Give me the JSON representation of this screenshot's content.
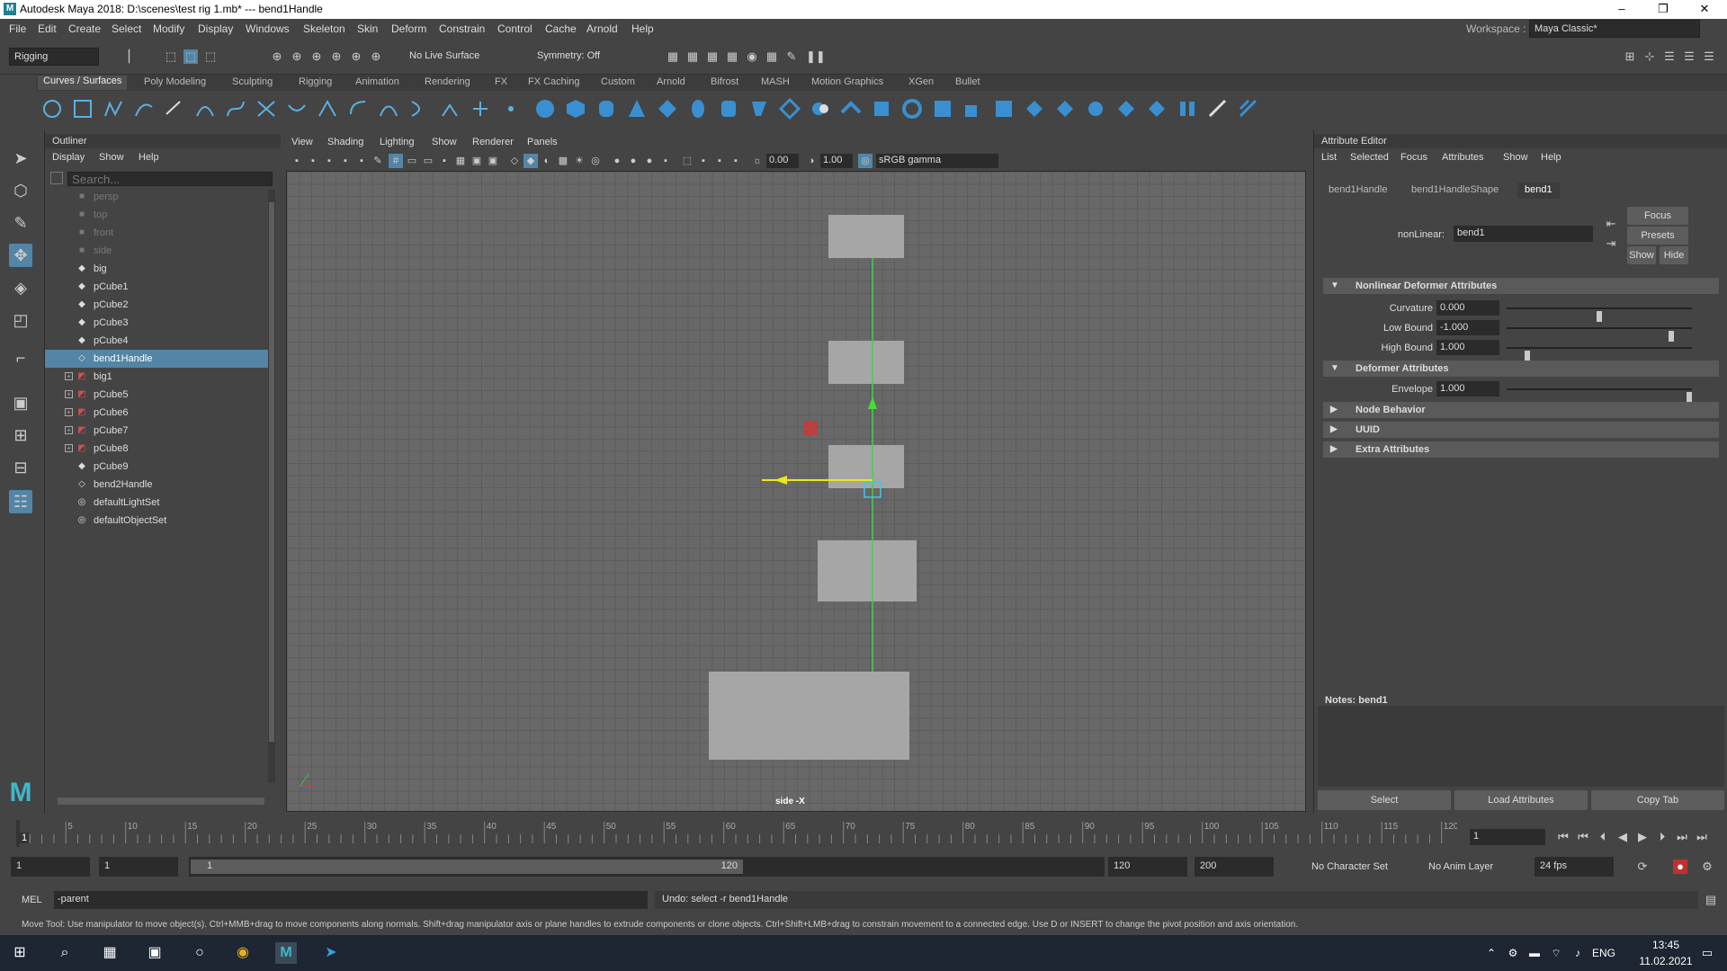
{
  "window": {
    "title": "Autodesk Maya 2018: D:\\scenes\\test rig 1.mb*  ---  bend1Handle",
    "logo": "M"
  },
  "menubar": {
    "items": [
      "File",
      "Edit",
      "Create",
      "Select",
      "Modify",
      "Display",
      "Windows",
      "Skeleton",
      "Skin",
      "Deform",
      "Constrain",
      "Control",
      "Cache",
      "Arnold",
      "Help"
    ],
    "workspace_label": "Workspace :",
    "workspace_value": "Maya Classic*"
  },
  "statusline": {
    "mode": "Rigging",
    "live_surface": "No Live Surface",
    "symmetry": "Symmetry: Off"
  },
  "shelf": {
    "tabs": [
      "Curves / Surfaces",
      "Poly Modeling",
      "Sculpting",
      "Rigging",
      "Animation",
      "Rendering",
      "FX",
      "FX Caching",
      "Custom",
      "Arnold",
      "Bifrost",
      "MASH",
      "Motion Graphics",
      "XGen",
      "Bullet"
    ],
    "active": "Curves / Surfaces"
  },
  "outliner": {
    "title": "Outliner",
    "menu": [
      "Display",
      "Show",
      "Help"
    ],
    "search_placeholder": "Search...",
    "items": [
      {
        "label": "persp",
        "icon": "camera-icon",
        "dim": true,
        "expand": false
      },
      {
        "label": "top",
        "icon": "camera-icon",
        "dim": true,
        "expand": false
      },
      {
        "label": "front",
        "icon": "camera-icon",
        "dim": true,
        "expand": false
      },
      {
        "label": "side",
        "icon": "camera-icon",
        "dim": true,
        "expand": false
      },
      {
        "label": "big",
        "icon": "mesh-icon",
        "dim": false,
        "expand": false
      },
      {
        "label": "pCube1",
        "icon": "mesh-icon",
        "dim": false,
        "expand": false
      },
      {
        "label": "pCube2",
        "icon": "mesh-icon",
        "dim": false,
        "expand": false
      },
      {
        "label": "pCube3",
        "icon": "mesh-icon",
        "dim": false,
        "expand": false
      },
      {
        "label": "pCube4",
        "icon": "mesh-icon",
        "dim": false,
        "expand": false
      },
      {
        "label": "bend1Handle",
        "icon": "deformer-handle-icon",
        "dim": false,
        "expand": false,
        "selected": true
      },
      {
        "label": "big1",
        "icon": "transform-icon",
        "dim": false,
        "expand": true
      },
      {
        "label": "pCube5",
        "icon": "transform-icon",
        "dim": false,
        "expand": true
      },
      {
        "label": "pCube6",
        "icon": "transform-icon",
        "dim": false,
        "expand": true
      },
      {
        "label": "pCube7",
        "icon": "transform-icon",
        "dim": false,
        "expand": true
      },
      {
        "label": "pCube8",
        "icon": "transform-icon",
        "dim": false,
        "expand": true
      },
      {
        "label": "pCube9",
        "icon": "mesh-icon",
        "dim": false,
        "expand": false
      },
      {
        "label": "bend2Handle",
        "icon": "deformer-handle-icon",
        "dim": false,
        "expand": false
      },
      {
        "label": "defaultLightSet",
        "icon": "set-icon",
        "dim": false,
        "expand": false
      },
      {
        "label": "defaultObjectSet",
        "icon": "set-icon",
        "dim": false,
        "expand": false
      }
    ]
  },
  "viewport": {
    "menu": [
      "View",
      "Shading",
      "Lighting",
      "Show",
      "Renderer",
      "Panels"
    ],
    "exposure": "0.00",
    "gamma": "1.00",
    "colorspace": "sRGB gamma",
    "camera_label": "side -X"
  },
  "attribute_editor": {
    "title": "Attribute Editor",
    "menu": [
      "List",
      "Selected",
      "Focus",
      "Attributes",
      "Show",
      "Help"
    ],
    "tabs": [
      "bend1Handle",
      "bend1HandleShape",
      "bend1"
    ],
    "active_tab": "bend1",
    "node_label": "nonLinear:",
    "node_value": "bend1",
    "buttons": {
      "focus": "Focus",
      "presets": "Presets",
      "show": "Show",
      "hide": "Hide"
    },
    "sections": {
      "nonlinear": "Nonlinear Deformer Attributes",
      "deformer": "Deformer Attributes",
      "node_behavior": "Node Behavior",
      "uuid": "UUID",
      "extra": "Extra Attributes"
    },
    "attrs": {
      "curvature": {
        "label": "Curvature",
        "value": "0.000",
        "slider": 0.5
      },
      "low_bound": {
        "label": "Low Bound",
        "value": "-1.000",
        "slider": 0.9
      },
      "high_bound": {
        "label": "High Bound",
        "value": "1.000",
        "slider": 0.1
      },
      "envelope": {
        "label": "Envelope",
        "value": "1.000",
        "slider": 1.0
      }
    },
    "notes_label": "Notes:  bend1",
    "bottom_buttons": [
      "Select",
      "Load Attributes",
      "Copy Tab"
    ]
  },
  "timeline": {
    "ticks": [
      "5",
      "10",
      "15",
      "20",
      "25",
      "30",
      "35",
      "40",
      "45",
      "50",
      "55",
      "60",
      "65",
      "70",
      "75",
      "80",
      "85",
      "90",
      "95",
      "100",
      "105",
      "110",
      "115",
      "120"
    ],
    "current_frame": "1",
    "start_marker": "1"
  },
  "range": {
    "start": "1",
    "anim_start": "1",
    "slider_start": "1",
    "slider_end": "120",
    "end": "120",
    "anim_end": "200",
    "character_set": "No Character Set",
    "anim_layer": "No Anim Layer",
    "fps": "24 fps"
  },
  "cmdline": {
    "lang": "MEL",
    "input": "-parent",
    "result": "Undo: select -r bend1Handle"
  },
  "helpline": "Move Tool: Use manipulator to move object(s). Ctrl+MMB+drag to move components along normals. Shift+drag manipulator axis or plane handles to extrude components or clone objects. Ctrl+Shift+LMB+drag to constrain movement to a connected edge. Use D or INSERT to change the pivot position and axis orientation.",
  "taskbar": {
    "lang": "ENG",
    "time": "13:45",
    "date": "11.02.2021"
  }
}
